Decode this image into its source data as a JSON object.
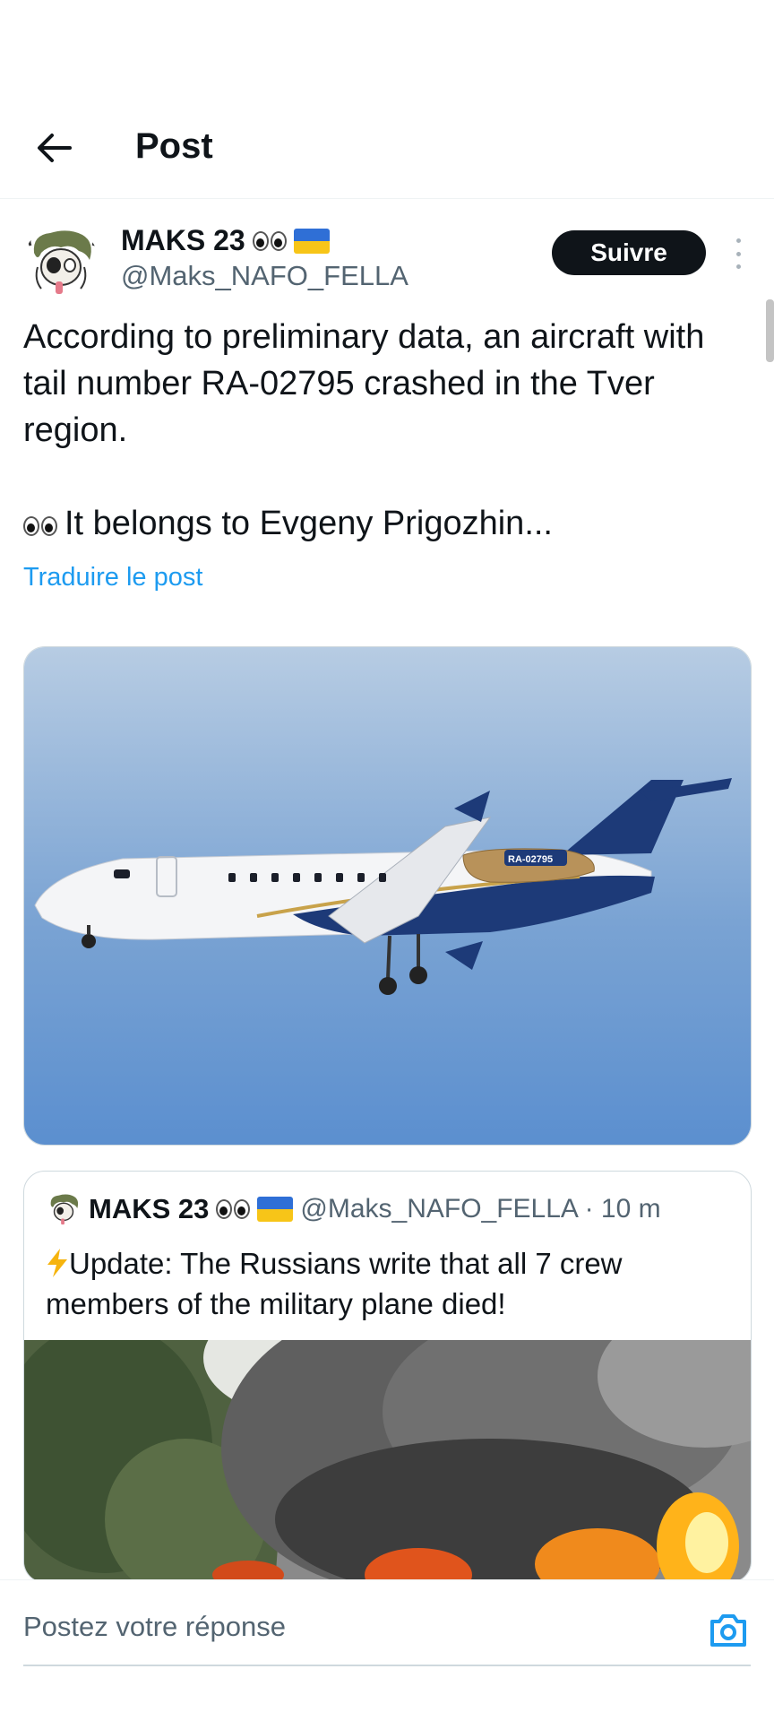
{
  "header": {
    "title": "Post",
    "back_icon": "arrow-left-icon"
  },
  "author": {
    "display_name": "MAKS 23",
    "name_emoji": [
      "eyes-emoji",
      "ukraine-flag-emoji"
    ],
    "handle": "@Maks_NAFO_FELLA",
    "follow_label": "Suivre"
  },
  "post": {
    "line1": "According to preliminary data, an aircraft with tail number RA-02795 crashed in the Tver region.",
    "line2": "It belongs to Evgeny Prigozhin...",
    "translate_label": "Traduire le post",
    "image_alt_tail": "RA-02795"
  },
  "quote": {
    "display_name": "MAKS 23",
    "handle_time": "@Maks_NAFO_FELLA · 10 m",
    "text": "Update: The Russians write that all 7 crew members of the military plane died!"
  },
  "reply": {
    "placeholder": "Postez votre réponse"
  },
  "colors": {
    "accent": "#1d9bf0",
    "text": "#0f1419",
    "muted": "#536471",
    "follow_bg": "#0f1419"
  }
}
